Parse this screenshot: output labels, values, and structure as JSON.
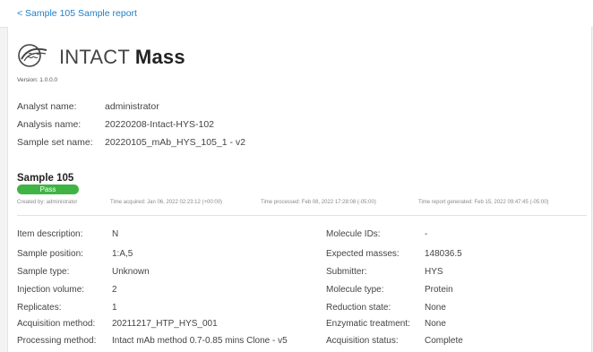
{
  "nav": {
    "back_link": "< Sample 105 Sample report"
  },
  "header": {
    "product_light": "INTACT",
    "product_bold": "Mass",
    "version": "Version: 1.0.0.0",
    "logo_icon": "intact-mass-logo-icon"
  },
  "analysis": {
    "analyst_label": "Analyst name:",
    "analyst_value": "administrator",
    "analysis_label": "Analysis name:",
    "analysis_value": "20220208-Intact-HYS-102",
    "sampleset_label": "Sample set name:",
    "sampleset_value": "20220105_mAb_HYS_105_1 - v2"
  },
  "sample": {
    "title": "Sample 105",
    "status": "Pass",
    "status_color": "#3fb445",
    "created_by": "Created by: administrator",
    "time_acquired": "Time acquired: Jan 06, 2022 02:23:12 (+00:00)",
    "time_processed": "Time processed: Feb 08, 2022 17:28:08 (-05:00)",
    "time_report": "Time report generated: Feb 15, 2022 09:47:45 (-05:00)"
  },
  "details_left": [
    {
      "label": "Item description:",
      "value": "N"
    },
    {
      "label": "Sample position:",
      "value": "1:A,5"
    },
    {
      "label": "Sample type:",
      "value": "Unknown"
    },
    {
      "label": "Injection volume:",
      "value": "2"
    },
    {
      "label": "Replicates:",
      "value": "1"
    },
    {
      "label": "Acquisition method:",
      "value": "20211217_HTP_HYS_001"
    },
    {
      "label": "Processing method:",
      "value": "Intact mAb method 0.7-0.85 mins Clone - v5"
    }
  ],
  "details_right": [
    {
      "label": "Molecule IDs:",
      "value": "-"
    },
    {
      "label": "Expected masses:",
      "value": "148036.5"
    },
    {
      "label": "Submitter:",
      "value": "HYS"
    },
    {
      "label": "Molecule type:",
      "value": "Protein"
    },
    {
      "label": "Reduction state:",
      "value": "None"
    },
    {
      "label": "Enzymatic treatment:",
      "value": "None"
    },
    {
      "label": "Acquisition status:",
      "value": "Complete"
    }
  ]
}
